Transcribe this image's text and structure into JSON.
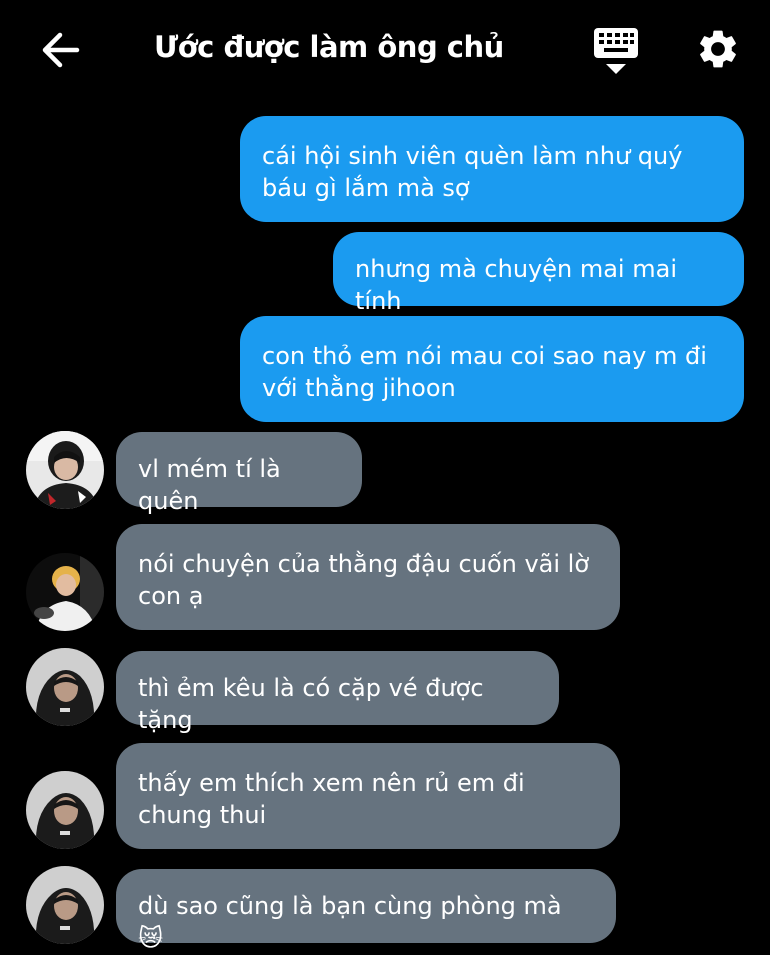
{
  "header": {
    "title": "Ước được làm ông chủ",
    "back_icon": "arrow-left-icon",
    "keyboard_icon": "keyboard-icon",
    "settings_icon": "gear-icon"
  },
  "colors": {
    "background": "#000000",
    "outgoing_bubble": "#1b9bf0",
    "incoming_bubble": "#66737f",
    "text": "#ffffff"
  },
  "messages": [
    {
      "direction": "outgoing",
      "text": "cái hội sinh viên quèn làm như quý báu gì lắm mà sợ"
    },
    {
      "direction": "outgoing",
      "text": "nhưng mà chuyện mai mai tính"
    },
    {
      "direction": "outgoing",
      "text": "con thỏ em nói mau coi sao nay m đi với thằng jihoon"
    },
    {
      "direction": "incoming",
      "text": "vl mém tí là quên"
    },
    {
      "direction": "incoming",
      "text": "nói chuyện của thằng đậu cuốn vãi lờ con ạ"
    },
    {
      "direction": "incoming",
      "text": "thì ẻm kêu là có cặp vé được tặng"
    },
    {
      "direction": "incoming",
      "text": "thấy em thích xem nên rủ em đi chung thui"
    },
    {
      "direction": "incoming",
      "text": "dù sao cũng là bạn cùng phòng mà 😿"
    }
  ]
}
